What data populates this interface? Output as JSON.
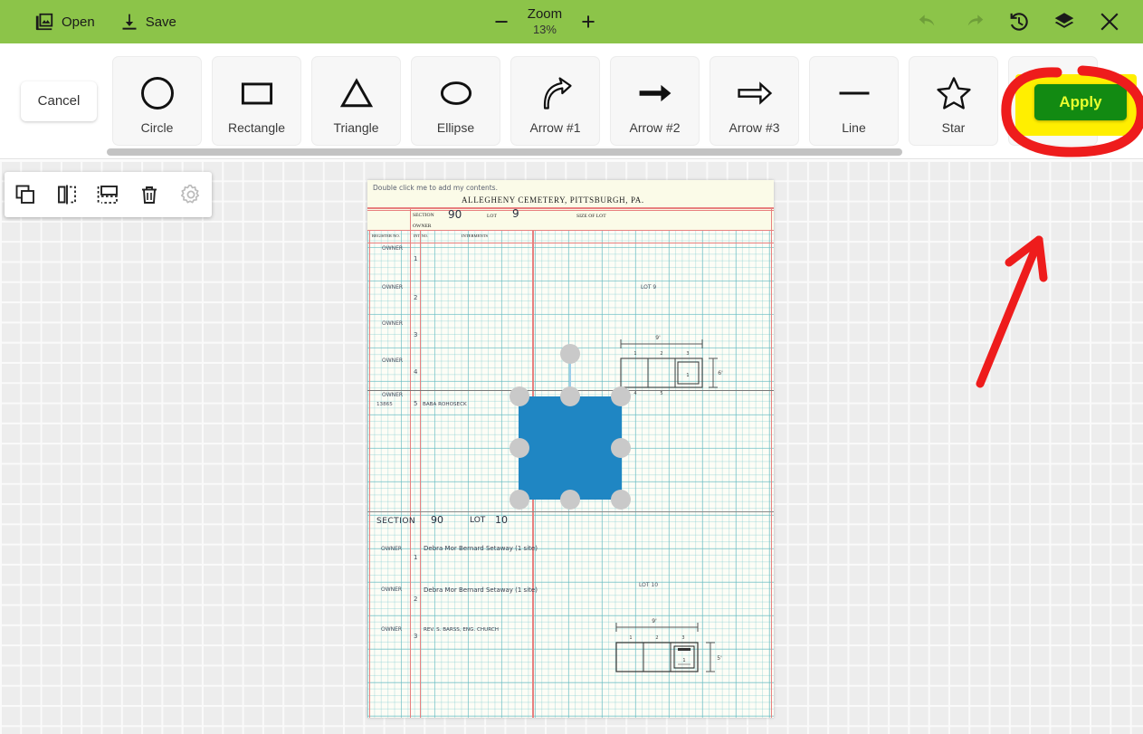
{
  "topbar": {
    "open_label": "Open",
    "save_label": "Save",
    "zoom_label": "Zoom",
    "zoom_value": "13%",
    "zoom_out_sign": "−",
    "zoom_in_sign": "+",
    "icons": {
      "open": "open-image-icon",
      "save": "save-download-icon",
      "undo": "undo-icon",
      "redo": "redo-icon",
      "history": "history-clock-icon",
      "layers": "layers-icon",
      "close": "close-icon"
    },
    "bg_color": "#8cc449"
  },
  "shapebar": {
    "cancel_label": "Cancel",
    "apply_label": "Apply",
    "apply_bg": "#128a12",
    "apply_fg": "#e9ff2e",
    "highlight_color": "#ffef00",
    "annotation_color": "#ee1c1c",
    "shapes": [
      {
        "label": "Circle",
        "icon": "circle-icon"
      },
      {
        "label": "Rectangle",
        "icon": "rectangle-icon"
      },
      {
        "label": "Triangle",
        "icon": "triangle-icon"
      },
      {
        "label": "Ellipse",
        "icon": "ellipse-icon"
      },
      {
        "label": "Arrow #1",
        "icon": "curved-arrow-icon"
      },
      {
        "label": "Arrow #2",
        "icon": "solid-arrow-icon"
      },
      {
        "label": "Arrow #3",
        "icon": "outline-arrow-icon"
      },
      {
        "label": "Line",
        "icon": "line-icon"
      },
      {
        "label": "Star",
        "icon": "star-icon"
      }
    ]
  },
  "objecttoolbar": {
    "buttons": [
      {
        "name": "duplicate-icon",
        "enabled": true
      },
      {
        "name": "flip-horizontal-icon",
        "enabled": true
      },
      {
        "name": "flip-vertical-icon",
        "enabled": true
      },
      {
        "name": "delete-trash-icon",
        "enabled": true
      },
      {
        "name": "settings-gear-icon",
        "enabled": false
      }
    ]
  },
  "canvas": {
    "selection": {
      "shape": "rectangle",
      "fill_color": "#1f86c3",
      "handle_color": "#c9c9c9",
      "handle_count": 8,
      "rotation_handle": true
    }
  },
  "document": {
    "placeholder_text": "Double click me to add my contents.",
    "title": "ALLEGHENY CEMETERY, PITTSBURGH, PA.",
    "header_fields": [
      {
        "label": "SECTION",
        "value": "90"
      },
      {
        "label": "LOT",
        "value": "9"
      },
      {
        "label": "SIZE OF LOT",
        "value": ""
      }
    ],
    "owner_label": "OWNER",
    "columns": [
      "REGISTER NO.",
      "INT. NO.",
      "INTERMENTS"
    ],
    "rows": [
      {
        "owner": "OWNER",
        "num": "1",
        "register": "",
        "interment": ""
      },
      {
        "owner": "OWNER",
        "num": "2",
        "register": "",
        "interment": ""
      },
      {
        "owner": "OWNER",
        "num": "3",
        "register": "",
        "interment": ""
      },
      {
        "owner": "OWNER",
        "num": "4",
        "register": "",
        "interment": ""
      },
      {
        "owner": "OWNER",
        "num": "5",
        "register": "13865",
        "interment": "BABA ROHOSECK"
      }
    ],
    "lot9_label": "LOT 9",
    "lot10_label": "LOT 10",
    "section2": {
      "label": "SECTION",
      "value": "90",
      "lot_label": "LOT",
      "lot_value": "10"
    },
    "owner_entries": [
      {
        "label": "OWNER",
        "num": "1",
        "text": "Debra Mor Bernard Setaway (1 site)"
      },
      {
        "label": "OWNER",
        "num": "2",
        "text": "Debra Mor Bernard Setaway (1 site)"
      },
      {
        "label": "OWNER",
        "num": "3",
        "text": "REV. S. BARSS, ENG. CHURCH"
      }
    ],
    "plot_diagrams": [
      {
        "width_label": "9'",
        "depth_label": "6'",
        "cells": [
          "1",
          "2",
          "3"
        ]
      },
      {
        "width_label": "9'",
        "depth_label": "5'",
        "cells": [
          "1",
          "2",
          "3"
        ]
      }
    ]
  }
}
